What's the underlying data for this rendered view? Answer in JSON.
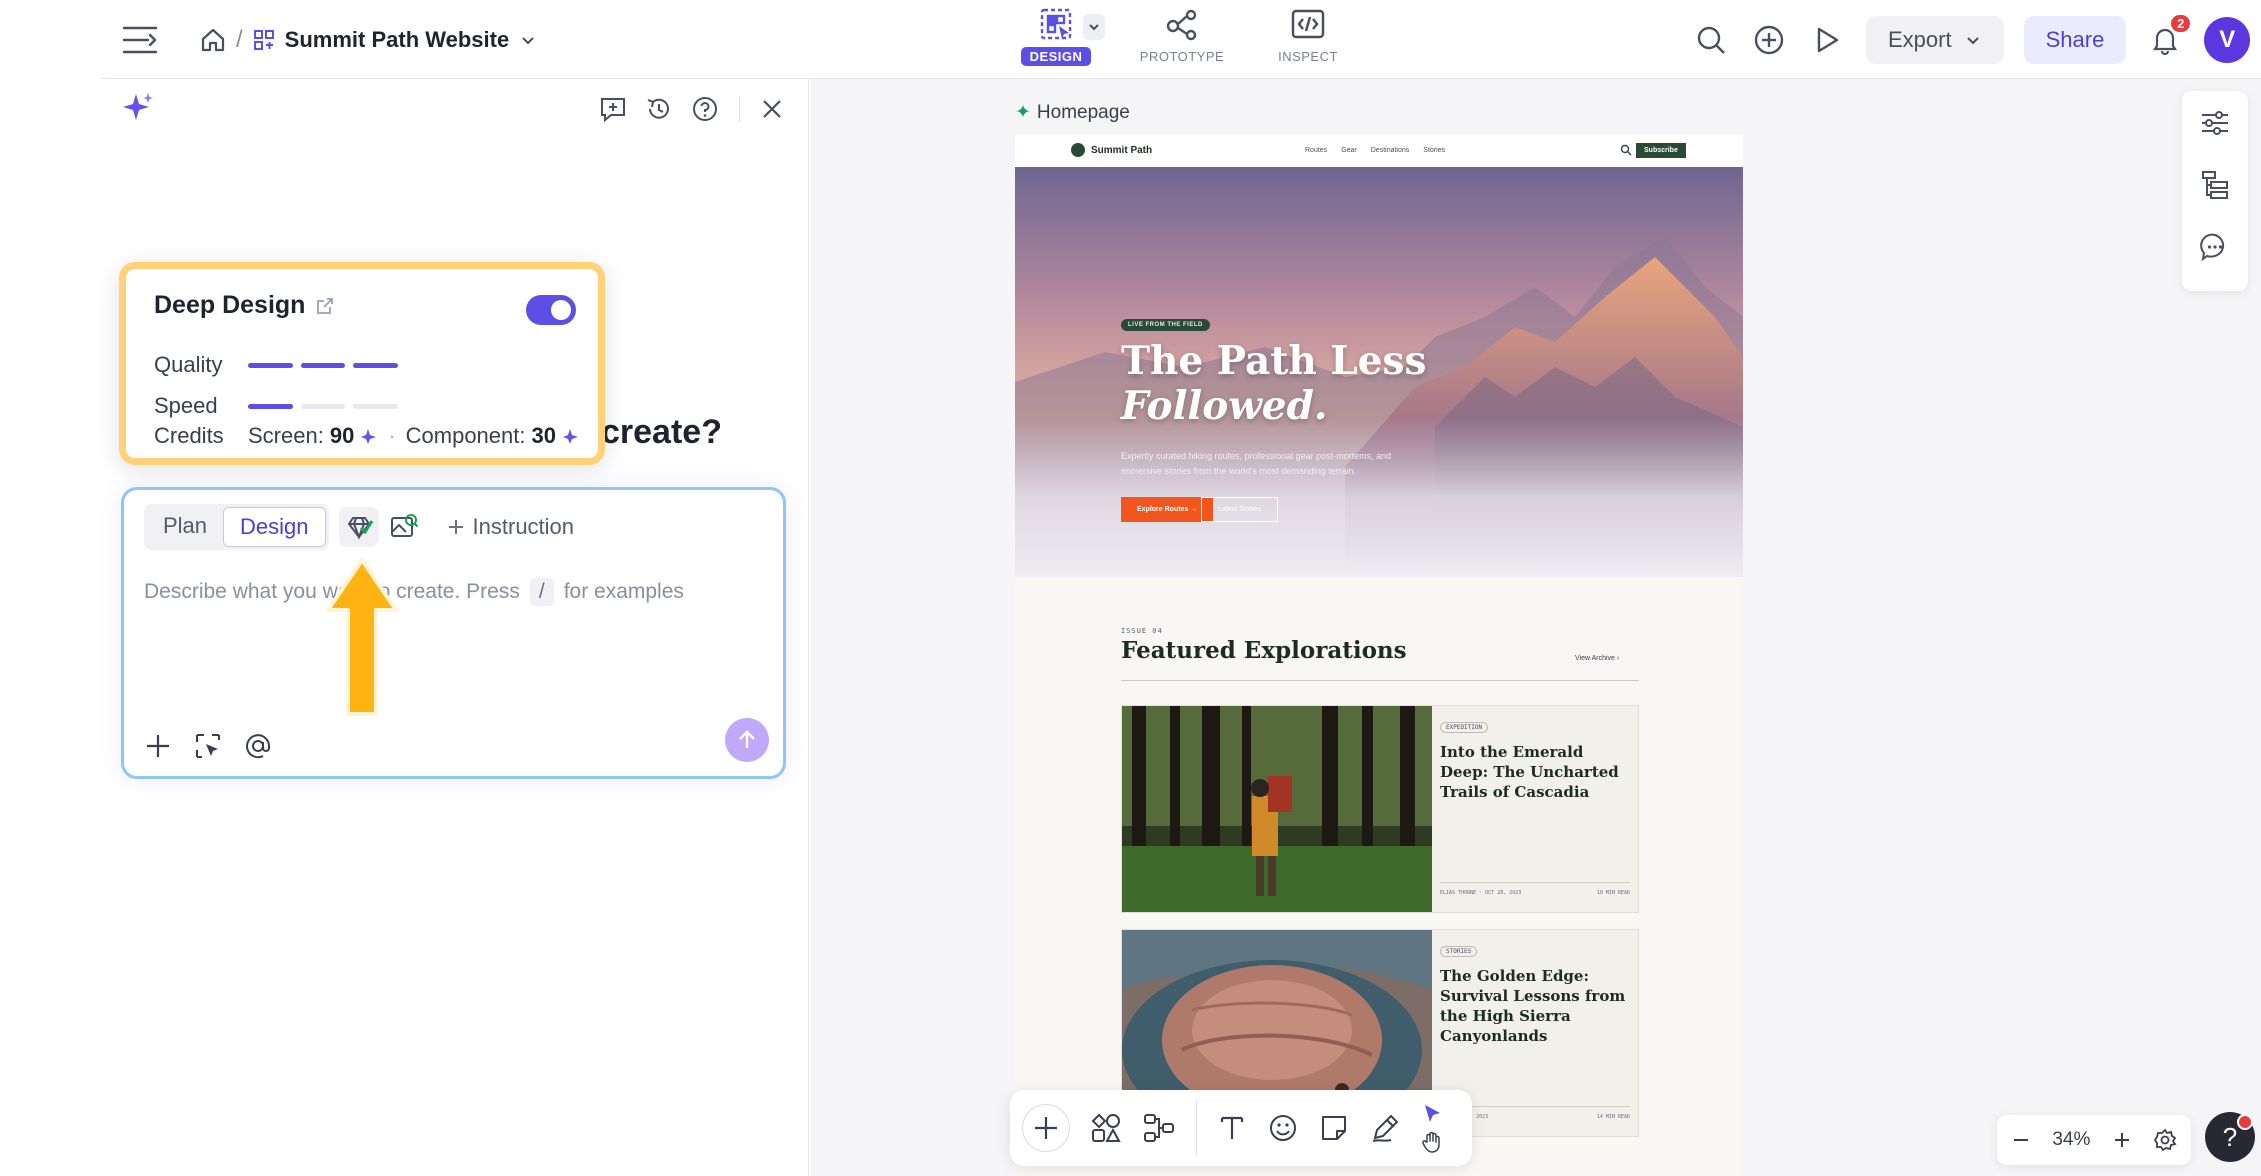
{
  "header": {
    "project_name": "Summit Path Website",
    "modes": [
      {
        "label": "DESIGN",
        "active": true
      },
      {
        "label": "PROTOTYPE",
        "active": false
      },
      {
        "label": "INSPECT",
        "active": false
      }
    ],
    "export_label": "Export",
    "share_label": "Share",
    "notification_count": "2",
    "avatar_letter": "V",
    "accent_color": "#5b4fe6"
  },
  "left_panel": {
    "heading_tail": "create?",
    "deep_design": {
      "title": "Deep Design",
      "enabled": true,
      "quality_label": "Quality",
      "quality_level": 3,
      "speed_label": "Speed",
      "speed_level": 1,
      "credits_label": "Credits",
      "screen_label": "Screen:",
      "screen_credits": "90",
      "component_label": "Component:",
      "component_credits": "30"
    },
    "composer": {
      "mode_plan": "Plan",
      "mode_design": "Design",
      "instruction_label": "Instruction",
      "placeholder_start": "Describe what you want to create. Press",
      "placeholder_key": "/",
      "placeholder_end": "for examples"
    }
  },
  "canvas": {
    "frame_label": "Homepage",
    "zoom": "34%",
    "site": {
      "brand": "Summit Path",
      "nav": [
        "Routes",
        "Gear",
        "Destinations",
        "Stories"
      ],
      "subscribe": "Subscribe",
      "hero_tag": "LIVE FROM THE FIELD",
      "hero_title_1": "The Path Less",
      "hero_title_2": "Followed.",
      "hero_copy": "Expertly curated hiking routes, professional gear post-mortems, and immersive stories from the world's most demanding terrain.",
      "hero_primary": "Explore Routes",
      "hero_secondary": "Latest Stories",
      "issue": "ISSUE 04",
      "featured_title": "Featured Explorations",
      "view_archive": "View Archive",
      "cards": [
        {
          "tag": "EXPEDITION",
          "title": "Into the Emerald Deep: The Uncharted Trails of Cascadia",
          "author": "ELIAS THORNE · OCT 28, 2023",
          "read": "10 MIN READ"
        },
        {
          "tag": "STORIES",
          "title": "The Golden Edge: Survival Lessons from the High Sierra Canyonlands",
          "author": "N · OCT 21, 2023",
          "read": "14 MIN READ"
        }
      ]
    }
  }
}
